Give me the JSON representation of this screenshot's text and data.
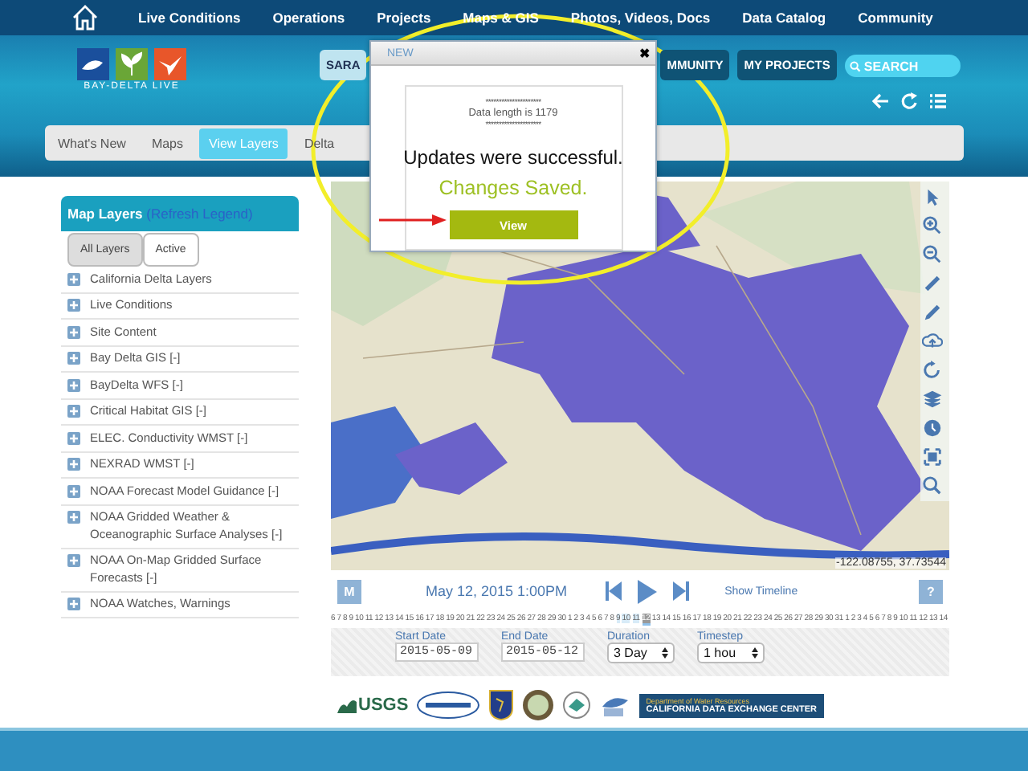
{
  "top_nav": {
    "items": [
      "Live Conditions",
      "Operations",
      "Projects",
      "Maps & GIS",
      "Photos, Videos, Docs",
      "Data Catalog",
      "Community"
    ]
  },
  "header": {
    "logo_text": "BAY-DELTA LIVE",
    "buttons": [
      {
        "label": "SARA",
        "kind": "light"
      },
      {
        "label": "MMUNITY",
        "kind": "dark"
      },
      {
        "label": "MY PROJECTS",
        "kind": "dark"
      }
    ],
    "search": {
      "placeholder": "SEARCH"
    }
  },
  "tabs": [
    {
      "label": "What's New",
      "selected": false
    },
    {
      "label": "Maps",
      "selected": false
    },
    {
      "label": "View Layers",
      "selected": true
    },
    {
      "label": "Delta",
      "selected": false
    }
  ],
  "sidebar": {
    "title": "Map Layers",
    "link": "(Refresh Legend)",
    "tabs": [
      {
        "label": "All Layers",
        "selected": true
      },
      {
        "label": "Active",
        "selected": false
      }
    ],
    "items": [
      "California Delta Layers",
      "Live Conditions",
      "Site Content",
      "Bay Delta GIS [-]",
      "BayDelta WFS [-]",
      "Critical Habitat GIS [-]",
      "ELEC. Conductivity WMST [-]",
      "NEXRAD WMST [-]",
      "NOAA Forecast Model Guidance [-]",
      "NOAA Gridded Weather & Oceanographic Surface Analyses [-]",
      "NOAA On-Map Gridded Surface Forecasts [-]",
      "NOAA Watches, Warnings"
    ]
  },
  "map": {
    "coordinates": "-122.08755, 37.73544"
  },
  "player": {
    "m_button": "M",
    "datetime": "May 12, 2015 1:00PM",
    "timeline_link": "Show Timeline",
    "help_button": "?"
  },
  "timeline_ticks": [
    {
      "label": "6",
      "selected": false,
      "current": false
    },
    {
      "label": "7",
      "selected": false,
      "current": false
    },
    {
      "label": "8",
      "selected": false,
      "current": false
    },
    {
      "label": "9",
      "selected": false,
      "current": false
    },
    {
      "label": "10",
      "selected": false,
      "current": false
    },
    {
      "label": "11",
      "selected": false,
      "current": false
    },
    {
      "label": "12",
      "selected": false,
      "current": false
    },
    {
      "label": "13",
      "selected": false,
      "current": false
    },
    {
      "label": "14",
      "selected": false,
      "current": false
    },
    {
      "label": "15",
      "selected": false,
      "current": false
    },
    {
      "label": "16",
      "selected": false,
      "current": false
    },
    {
      "label": "17",
      "selected": false,
      "current": false
    },
    {
      "label": "18",
      "selected": false,
      "current": false
    },
    {
      "label": "19",
      "selected": false,
      "current": false
    },
    {
      "label": "20",
      "selected": false,
      "current": false
    },
    {
      "label": "21",
      "selected": false,
      "current": false
    },
    {
      "label": "22",
      "selected": false,
      "current": false
    },
    {
      "label": "23",
      "selected": false,
      "current": false
    },
    {
      "label": "24",
      "selected": false,
      "current": false
    },
    {
      "label": "25",
      "selected": false,
      "current": false
    },
    {
      "label": "26",
      "selected": false,
      "current": false
    },
    {
      "label": "27",
      "selected": false,
      "current": false
    },
    {
      "label": "28",
      "selected": false,
      "current": false
    },
    {
      "label": "29",
      "selected": false,
      "current": false
    },
    {
      "label": "30",
      "selected": false,
      "current": false
    },
    {
      "label": "1",
      "selected": false,
      "current": false
    },
    {
      "label": "2",
      "selected": false,
      "current": false
    },
    {
      "label": "3",
      "selected": false,
      "current": false
    },
    {
      "label": "4",
      "selected": false,
      "current": false
    },
    {
      "label": "5",
      "selected": false,
      "current": false
    },
    {
      "label": "6",
      "selected": false,
      "current": false
    },
    {
      "label": "7",
      "selected": false,
      "current": false
    },
    {
      "label": "8",
      "selected": false,
      "current": false
    },
    {
      "label": "9",
      "selected": true,
      "current": false
    },
    {
      "label": "10",
      "selected": true,
      "current": false
    },
    {
      "label": "11",
      "selected": true,
      "current": false
    },
    {
      "label": "12",
      "selected": true,
      "current": true
    },
    {
      "label": "13",
      "selected": false,
      "current": false
    },
    {
      "label": "14",
      "selected": false,
      "current": false
    },
    {
      "label": "15",
      "selected": false,
      "current": false
    },
    {
      "label": "16",
      "selected": false,
      "current": false
    },
    {
      "label": "17",
      "selected": false,
      "current": false
    },
    {
      "label": "18",
      "selected": false,
      "current": false
    },
    {
      "label": "19",
      "selected": false,
      "current": false
    },
    {
      "label": "20",
      "selected": false,
      "current": false
    },
    {
      "label": "21",
      "selected": false,
      "current": false
    },
    {
      "label": "22",
      "selected": false,
      "current": false
    },
    {
      "label": "23",
      "selected": false,
      "current": false
    },
    {
      "label": "24",
      "selected": false,
      "current": false
    },
    {
      "label": "25",
      "selected": false,
      "current": false
    },
    {
      "label": "26",
      "selected": false,
      "current": false
    },
    {
      "label": "27",
      "selected": false,
      "current": false
    },
    {
      "label": "28",
      "selected": false,
      "current": false
    },
    {
      "label": "29",
      "selected": false,
      "current": false
    },
    {
      "label": "30",
      "selected": false,
      "current": false
    },
    {
      "label": "31",
      "selected": false,
      "current": false
    },
    {
      "label": "1",
      "selected": false,
      "current": false
    },
    {
      "label": "2",
      "selected": false,
      "current": false
    },
    {
      "label": "3",
      "selected": false,
      "current": false
    },
    {
      "label": "4",
      "selected": false,
      "current": false
    },
    {
      "label": "5",
      "selected": false,
      "current": false
    },
    {
      "label": "6",
      "selected": false,
      "current": false
    },
    {
      "label": "7",
      "selected": false,
      "current": false
    },
    {
      "label": "8",
      "selected": false,
      "current": false
    },
    {
      "label": "9",
      "selected": false,
      "current": false
    },
    {
      "label": "10",
      "selected": false,
      "current": false
    },
    {
      "label": "11",
      "selected": false,
      "current": false
    },
    {
      "label": "12",
      "selected": false,
      "current": false
    },
    {
      "label": "13",
      "selected": false,
      "current": false
    },
    {
      "label": "14",
      "selected": false,
      "current": false
    }
  ],
  "date_controls": [
    {
      "label": "Start Date",
      "value": "2015-05-09",
      "kind": "date"
    },
    {
      "label": "End Date",
      "value": "2015-05-12",
      "kind": "date"
    },
    {
      "label": "Duration",
      "value": "3 Day",
      "kind": "select"
    },
    {
      "label": "Timestep",
      "value": "1 hou",
      "kind": "select"
    }
  ],
  "partner_logos": {
    "usgs": "USGS",
    "dwr_line1": "Department of Water Resources",
    "dwr_line2": "CALIFORNIA DATA EXCHANGE CENTER"
  },
  "dialog": {
    "title": "NEW",
    "close": "✖",
    "separator_top": "*********************",
    "info": "Data length is 1179",
    "separator_bottom": "*********************",
    "message": "Updates were successful.",
    "status": "Changes Saved.",
    "button": "View"
  }
}
